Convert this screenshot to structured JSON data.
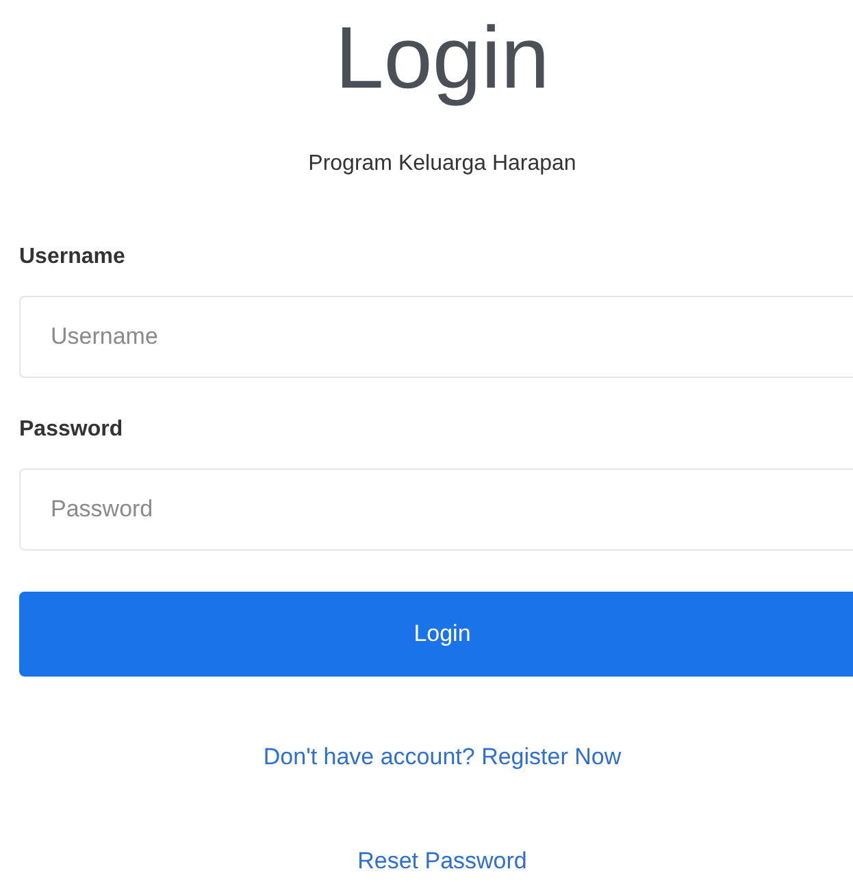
{
  "title": "Login",
  "subtitle": "Program Keluarga Harapan",
  "fields": [
    {
      "label": "Username",
      "placeholder": "Username"
    },
    {
      "label": "Password",
      "placeholder": "Password"
    }
  ],
  "submit": "Login",
  "links": [
    {
      "text": "Don't have account? Register Now"
    },
    {
      "text": "Reset Password"
    }
  ]
}
